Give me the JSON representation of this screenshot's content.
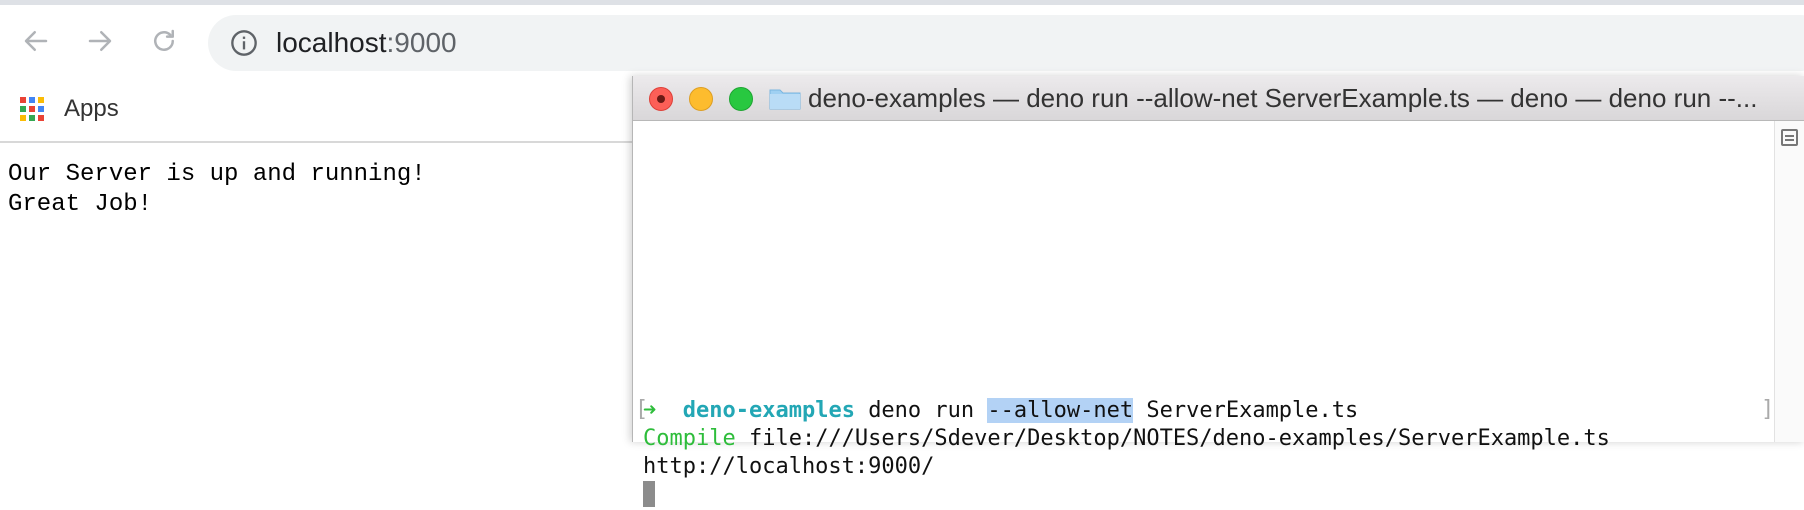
{
  "browser": {
    "url_host": "localhost",
    "url_port": ":9000",
    "bookmarks": {
      "apps_label": "Apps"
    },
    "apps_colors": [
      "#ea4335",
      "#4285f4",
      "#fbbc05",
      "#34a853",
      "#ea4335",
      "#4285f4",
      "#fbbc05",
      "#34a853",
      "#ea4335"
    ]
  },
  "page": {
    "lines": [
      "Our Server is up and running!",
      "Great Job!"
    ]
  },
  "terminal": {
    "title": "deno-examples — deno run --allow-net ServerExample.ts — deno — deno run --...",
    "prompt_arrow": "➜",
    "cwd": "deno-examples",
    "command_part1": "deno run",
    "command_flag": "--allow-net",
    "command_part2": "ServerExample.ts",
    "compile_label": "Compile",
    "compile_path": "file:///Users/Sdever/Desktop/NOTES/deno-examples/ServerExample.ts",
    "server_url": "http://localhost:9000/"
  },
  "colors": {
    "prompt_arrow": "#2ebd3b",
    "cwd": "#23a7b5",
    "selection": "#b3d2f5"
  }
}
